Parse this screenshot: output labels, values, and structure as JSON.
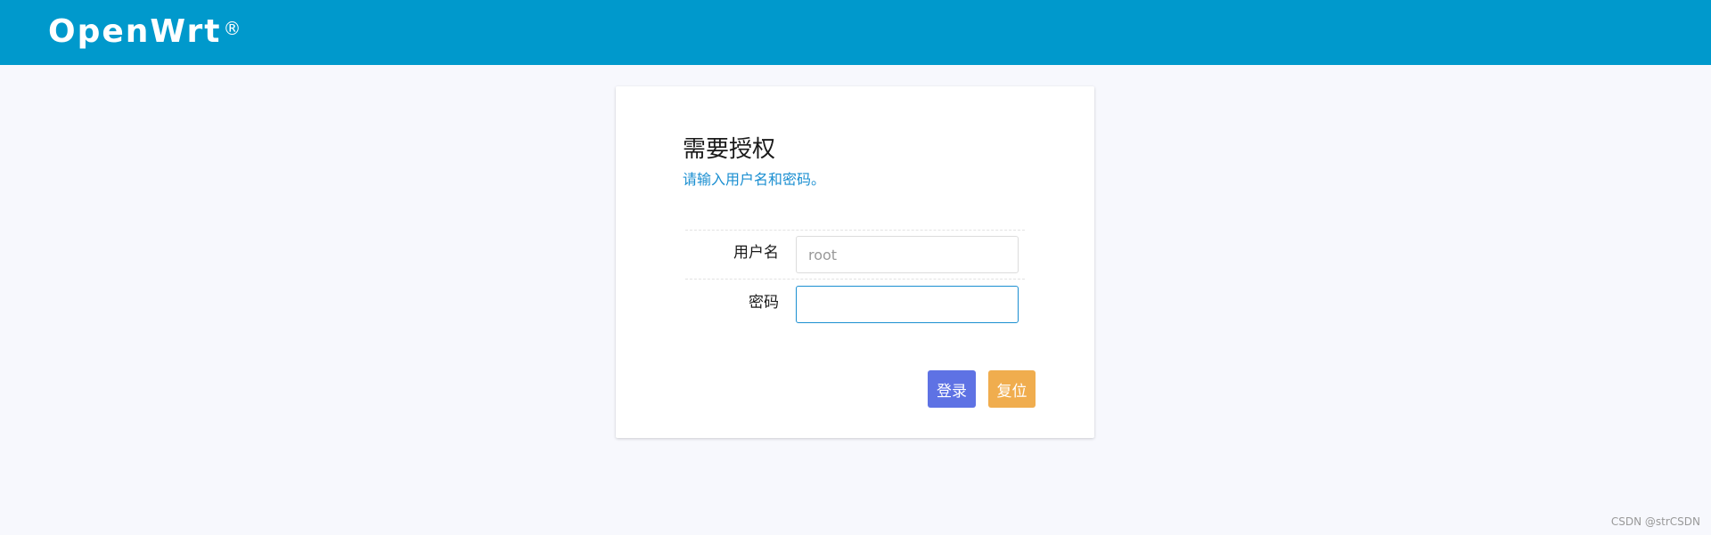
{
  "header": {
    "brand": "OpenWrt",
    "brand_mark": "®",
    "background_color": "#0099cc"
  },
  "login": {
    "title": "需要授权",
    "subtitle": "请输入用户名和密码。",
    "username_label": "用户名",
    "username_value": "root",
    "password_label": "密码",
    "password_value": "",
    "login_button": "登录",
    "reset_button": "复位",
    "login_color": "#5e72e4",
    "reset_color": "#f0ad4e",
    "accent_color": "#1b8fd1"
  },
  "watermark": "CSDN @strCSDN"
}
